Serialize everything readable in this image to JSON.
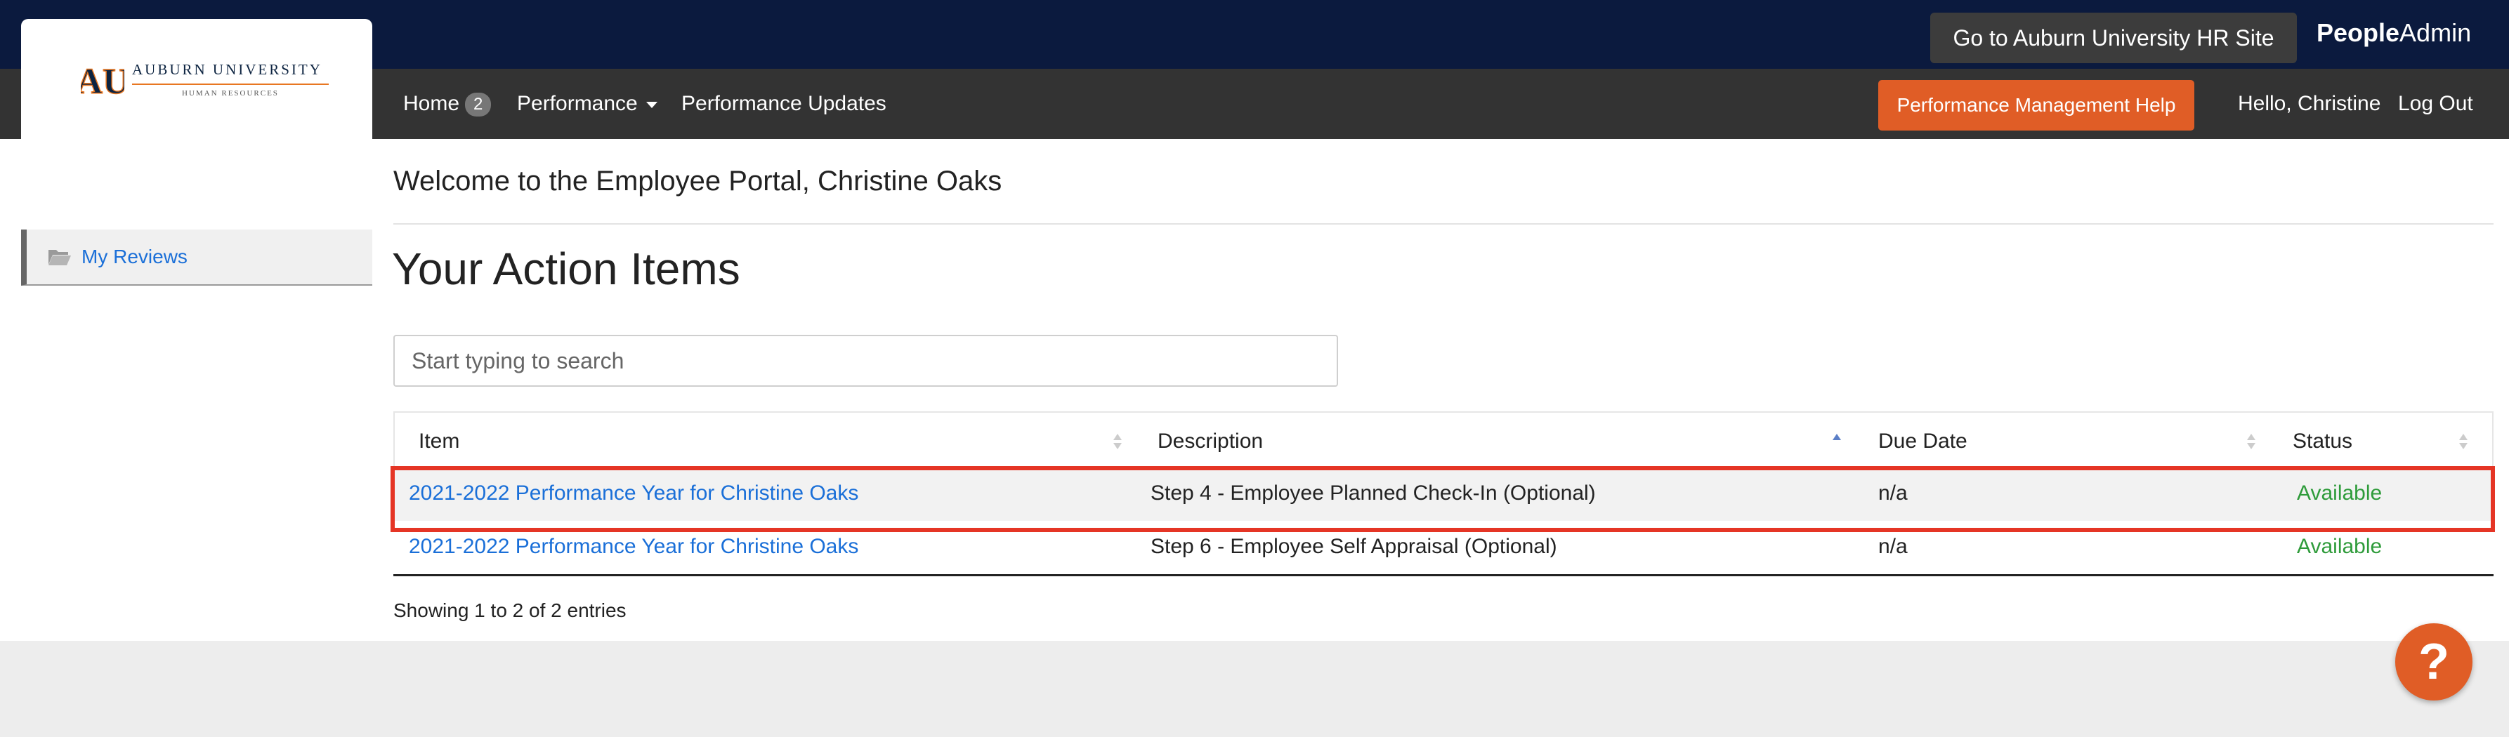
{
  "branding": {
    "logo_title": "AUBURN UNIVERSITY",
    "logo_subtitle": "HUMAN RESOURCES",
    "logo_mark": "AU",
    "vendor_bold": "People",
    "vendor_rest": "Admin",
    "colors": {
      "topbar": "#0b1a3e",
      "navbar": "#333333",
      "accent": "#e05d26",
      "link": "#1a6fd8",
      "status_ok": "#2e9b3a",
      "highlight": "#e53525"
    }
  },
  "header": {
    "hr_site_button": "Go to Auburn University HR Site",
    "help_button": "Performance Management Help",
    "greeting": "Hello, Christine",
    "logout": "Log Out"
  },
  "nav": {
    "home": "Home",
    "home_badge": "2",
    "performance": "Performance",
    "performance_updates": "Performance Updates"
  },
  "sidebar": {
    "items": [
      {
        "label": "My Reviews",
        "icon": "folder-open-icon"
      }
    ]
  },
  "main": {
    "welcome": "Welcome to the Employee Portal, Christine Oaks",
    "title": "Your Action Items",
    "search_placeholder": "Start typing to search",
    "columns": [
      "Item",
      "Description",
      "Due Date",
      "Status"
    ],
    "sorted_column": "Description",
    "rows": [
      {
        "item": "2021-2022 Performance Year for Christine Oaks",
        "description": "Step 4 - Employee Planned Check-In (Optional)",
        "due": "n/a",
        "status": "Available",
        "highlighted": true
      },
      {
        "item": "2021-2022 Performance Year for Christine Oaks",
        "description": "Step 6 - Employee Self Appraisal (Optional)",
        "due": "n/a",
        "status": "Available",
        "highlighted": false
      }
    ],
    "info": "Showing 1 to 2 of 2 entries"
  },
  "help_fab": {
    "label": "?",
    "icon": "question-icon"
  }
}
